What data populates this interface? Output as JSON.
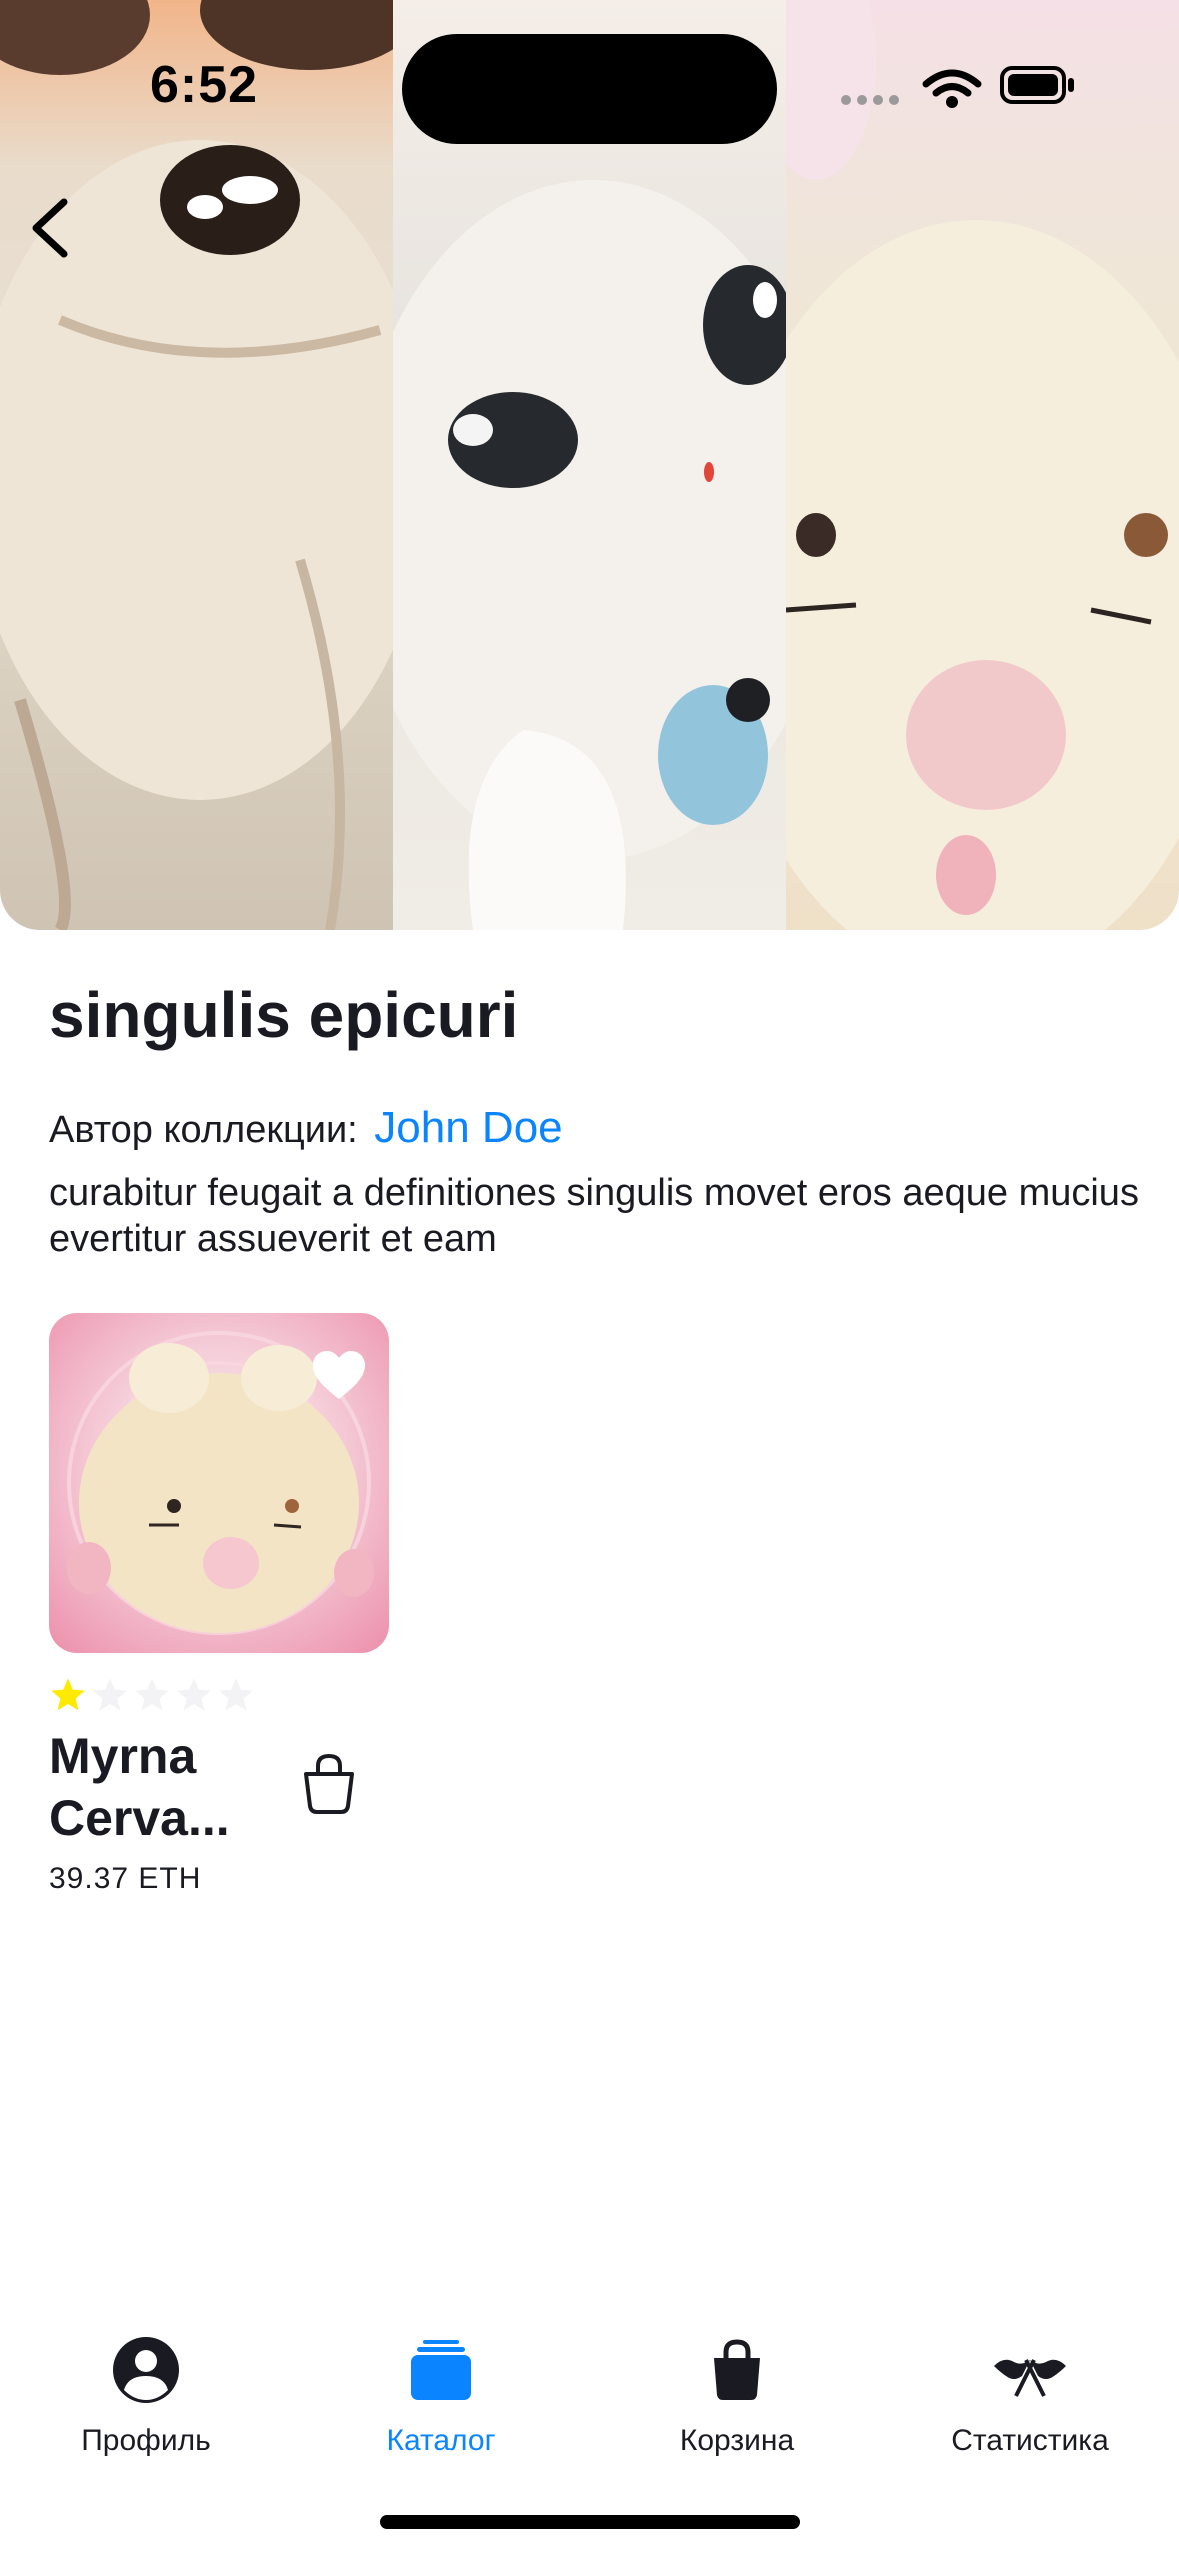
{
  "status_bar": {
    "time": "6:52"
  },
  "collection": {
    "title": "singulis epicuri",
    "author_prefix": "Автор коллекции:",
    "author_name": "John Doe",
    "description": "curabitur feugait a definitiones singulis movet eros aeque mucius evertitur assueverit et eam"
  },
  "nfts": [
    {
      "name": "Myrna Cerva...",
      "price": "39.37 ETH",
      "rating": 1,
      "rating_max": 5,
      "liked": true
    }
  ],
  "tabbar": {
    "tabs": [
      {
        "label": "Профиль",
        "icon": "profile-icon",
        "active": false
      },
      {
        "label": "Каталог",
        "icon": "catalog-icon",
        "active": true
      },
      {
        "label": "Корзина",
        "icon": "cart-icon",
        "active": false
      },
      {
        "label": "Статистика",
        "icon": "statistics-icon",
        "active": false
      }
    ]
  },
  "colors": {
    "accent": "#0a84ff",
    "star_active": "#fee900",
    "star_inactive": "#f7f7f8",
    "text_primary": "#1a1b22"
  }
}
